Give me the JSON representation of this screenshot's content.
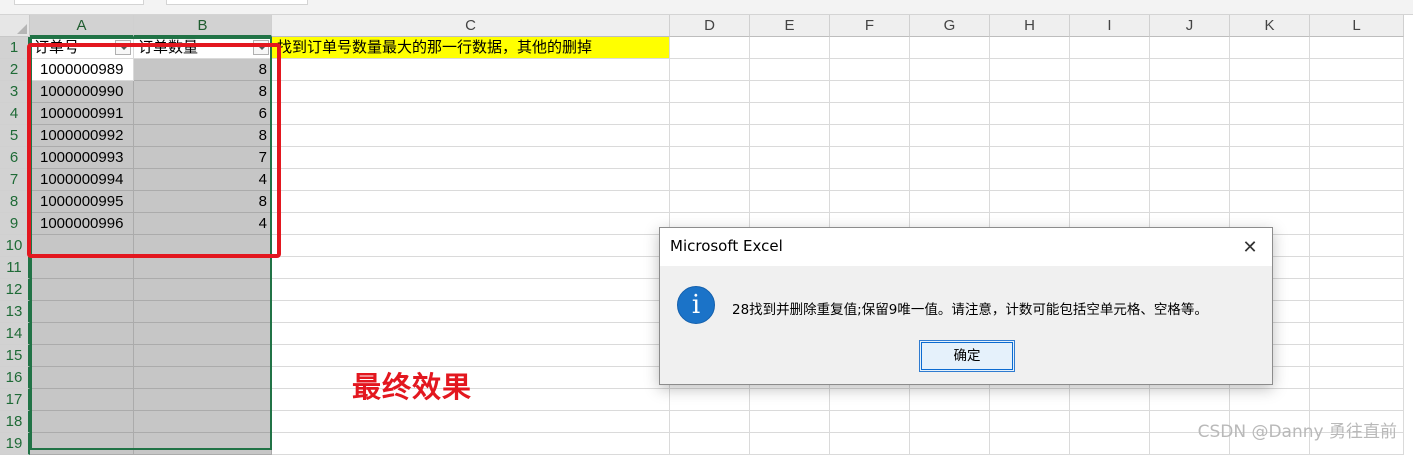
{
  "sheet": {
    "columns": [
      "A",
      "B",
      "C",
      "D",
      "E",
      "F",
      "G",
      "H",
      "I",
      "J",
      "K",
      "L"
    ],
    "rows": [
      "1",
      "2",
      "3",
      "4",
      "5",
      "6",
      "7",
      "8",
      "9",
      "10",
      "11",
      "12",
      "13",
      "14",
      "15",
      "16",
      "17",
      "18",
      "19"
    ],
    "header": {
      "col_a": "订单号",
      "col_b": "订单数量"
    },
    "note": "找到订单号数量最大的那一行数据，其他的删掉",
    "data": [
      {
        "id": "1000000989",
        "qty": "8"
      },
      {
        "id": "1000000990",
        "qty": "8"
      },
      {
        "id": "1000000991",
        "qty": "6"
      },
      {
        "id": "1000000992",
        "qty": "8"
      },
      {
        "id": "1000000993",
        "qty": "7"
      },
      {
        "id": "1000000994",
        "qty": "4"
      },
      {
        "id": "1000000995",
        "qty": "8"
      },
      {
        "id": "1000000996",
        "qty": "4"
      }
    ]
  },
  "annotation": {
    "final_label": "最终效果"
  },
  "dialog": {
    "title": "Microsoft Excel",
    "close_symbol": "✕",
    "icon_glyph": "i",
    "message": "28找到并删除重复值;保留9唯一值。请注意，计数可能包括空单元格、空格等。",
    "ok_label": "确定"
  },
  "watermark": "CSDN @Danny 勇往直前",
  "colors": {
    "highlight": "#ffff00",
    "annotation_red": "#e3171f",
    "selection_green": "#217346",
    "info_blue": "#1b73c8"
  }
}
